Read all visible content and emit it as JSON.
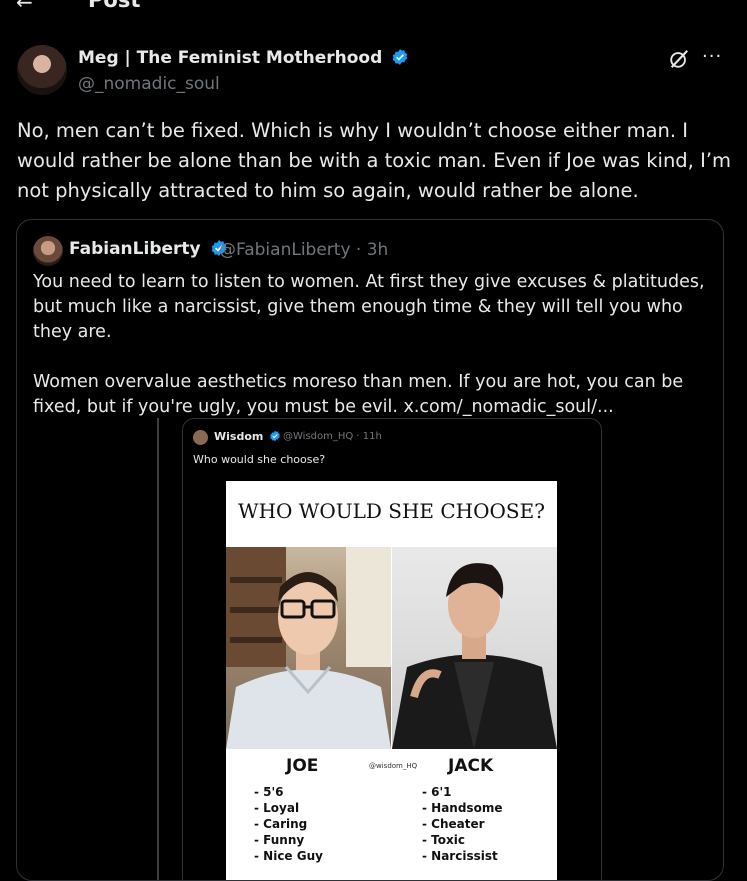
{
  "header": {
    "title": "Post"
  },
  "post": {
    "author_name": "Meg | The Feminist Motherhood",
    "author_handle": "@_nomadic_soul",
    "text": "No, men can’t be fixed. Which is why I wouldn’t choose either man. I would rather be alone than be with a toxic man. Even if Joe was kind, I’m not physically attracted to him so again, would rather be alone."
  },
  "quote": {
    "author_name": "FabianLiberty",
    "author_handle": "@FabianLiberty · 3h",
    "paragraph1": "You need to learn to listen to women. At first they give excuses & platitudes, but much like a narcissist, give them enough time & they will tell you who they are.",
    "paragraph2": "Women overvalue aesthetics moreso than men. If you are hot, you can be fixed, but if you're ugly, you must be evil.  x.com/_nomadic_soul/..."
  },
  "inner_tweet": {
    "author_name": "Wisdom",
    "author_handle": "@Wisdom_HQ · 11h",
    "text": "Who would she choose?"
  },
  "meme": {
    "title": "WHO WOULD SHE CHOOSE?",
    "watermark": "@wisdom_HQ",
    "left_name": "JOE",
    "right_name": "JACK",
    "left_traits": [
      "- 5'6",
      "- Loyal",
      "- Caring",
      "- Funny",
      "- Nice Guy"
    ],
    "right_traits": [
      "- 6'1",
      "- Handsome",
      "- Cheater",
      "- Toxic",
      "- Narcissist"
    ]
  },
  "colors": {
    "background": "#000000",
    "text": "#e7e9ea",
    "muted": "#71767b",
    "verified": "#1d9bf0",
    "border": "#2f3336"
  },
  "icons": [
    "back-arrow-icon",
    "verified-icon",
    "grok-icon",
    "more-icon"
  ]
}
